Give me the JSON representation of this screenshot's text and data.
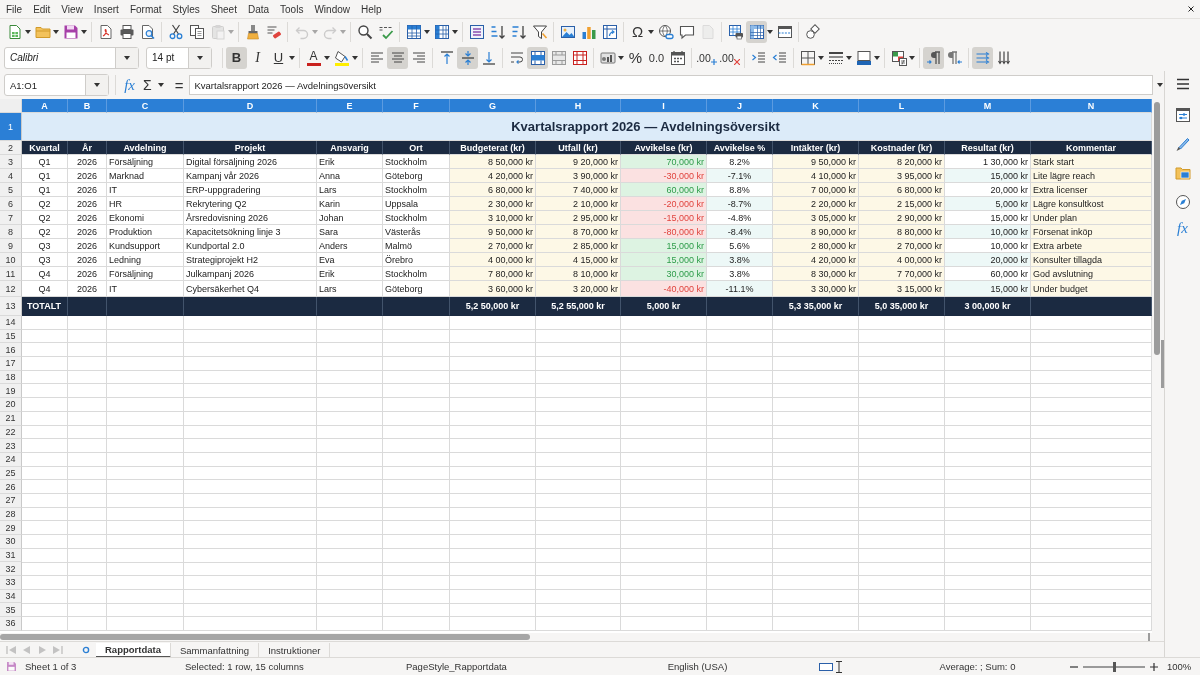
{
  "menu_bar": [
    "File",
    "Edit",
    "View",
    "Insert",
    "Format",
    "Styles",
    "Sheet",
    "Data",
    "Tools",
    "Window",
    "Help"
  ],
  "standard_toolbar": {
    "paste_enabled": false,
    "undo_enabled": false,
    "redo_enabled": false,
    "special_character": "Ω",
    "header_footer_enabled": false,
    "freeze_rows_columns": true
  },
  "formatting_toolbar": {
    "font_name": "Calibri",
    "font_size": "14 pt",
    "bold": {
      "label": "B",
      "on": true
    },
    "italic": {
      "label": "I",
      "on": false
    },
    "underline": {
      "label": "U",
      "on": false
    },
    "font_color_label": "A",
    "align_left": false,
    "align_center": true,
    "align_right": false,
    "align_top": false,
    "align_middle": true,
    "align_bottom": false,
    "merge_and_center": true,
    "percent": "%",
    "number_format": "0.0",
    "add_decimal": ".00",
    "delete_decimal": ".00",
    "left_to_right": true,
    "right_to_left": false,
    "text_horizontal": true,
    "text_vertical": false
  },
  "formula_bar": {
    "name_box": "A1:O1",
    "function_wizard": "fx",
    "sum": "Σ",
    "equals": "=",
    "content": "Kvartalsrapport 2026 — Avdelningsöversikt"
  },
  "sheet": {
    "columns": [
      {
        "letter": "A",
        "selected": true
      },
      {
        "letter": "B",
        "selected": true
      },
      {
        "letter": "C",
        "selected": true
      },
      {
        "letter": "D",
        "selected": true
      },
      {
        "letter": "E",
        "selected": true
      },
      {
        "letter": "F",
        "selected": true
      },
      {
        "letter": "G",
        "selected": true
      },
      {
        "letter": "H",
        "selected": true
      },
      {
        "letter": "I",
        "selected": true
      },
      {
        "letter": "J",
        "selected": true
      },
      {
        "letter": "K",
        "selected": true
      },
      {
        "letter": "L",
        "selected": true
      },
      {
        "letter": "M",
        "selected": true
      },
      {
        "letter": "N",
        "selected": true
      }
    ],
    "title_row": {
      "row": "1",
      "selected": true,
      "text": "Kvartalsrapport 2026 — Avdelningsöversikt"
    },
    "header_row": {
      "row": "2",
      "selected": false,
      "cells": [
        "Kvartal",
        "År",
        "Avdelning",
        "Projekt",
        "Ansvarig",
        "Ort",
        "Budgeterat (kr)",
        "Utfall (kr)",
        "Avvikelse (kr)",
        "Avvikelse %",
        "Intäkter (kr)",
        "Kostnader (kr)",
        "Resultat (kr)",
        "Kommentar"
      ]
    },
    "rows": [
      {
        "row": "3",
        "selected": false,
        "variance_positive": true,
        "cells": [
          "Q1",
          "2026",
          "Försäljning",
          "Digital försäljning 2026",
          "Erik",
          "Stockholm",
          "8 50,000 kr",
          "9 20,000 kr",
          "70,000 kr",
          "8.2%",
          "9 50,000 kr",
          "8 20,000 kr",
          "1 30,000 kr",
          "Stark start"
        ]
      },
      {
        "row": "4",
        "selected": false,
        "variance_positive": false,
        "cells": [
          "Q1",
          "2026",
          "Marknad",
          "Kampanj vår 2026",
          "Anna",
          "Göteborg",
          "4 20,000 kr",
          "3 90,000 kr",
          "-30,000 kr",
          "-7.1%",
          "4 10,000 kr",
          "3 95,000 kr",
          "15,000 kr",
          "Lite lägre reach"
        ]
      },
      {
        "row": "5",
        "selected": false,
        "variance_positive": true,
        "cells": [
          "Q1",
          "2026",
          "IT",
          "ERP-uppgradering",
          "Lars",
          "Stockholm",
          "6 80,000 kr",
          "7 40,000 kr",
          "60,000 kr",
          "8.8%",
          "7 00,000 kr",
          "6 80,000 kr",
          "20,000 kr",
          "Extra licenser"
        ]
      },
      {
        "row": "6",
        "selected": false,
        "variance_positive": false,
        "cells": [
          "Q2",
          "2026",
          "HR",
          "Rekrytering Q2",
          "Karin",
          "Uppsala",
          "2 30,000 kr",
          "2 10,000 kr",
          "-20,000 kr",
          "-8.7%",
          "2 20,000 kr",
          "2 15,000 kr",
          "5,000 kr",
          "Lägre konsultkost"
        ]
      },
      {
        "row": "7",
        "selected": false,
        "variance_positive": false,
        "cells": [
          "Q2",
          "2026",
          "Ekonomi",
          "Årsredovisning 2026",
          "Johan",
          "Stockholm",
          "3 10,000 kr",
          "2 95,000 kr",
          "-15,000 kr",
          "-4.8%",
          "3 05,000 kr",
          "2 90,000 kr",
          "15,000 kr",
          "Under plan"
        ]
      },
      {
        "row": "8",
        "selected": false,
        "variance_positive": false,
        "cells": [
          "Q2",
          "2026",
          "Produktion",
          "Kapacitetsökning linje 3",
          "Sara",
          "Västerås",
          "9 50,000 kr",
          "8 70,000 kr",
          "-80,000 kr",
          "-8.4%",
          "8 90,000 kr",
          "8 80,000 kr",
          "10,000 kr",
          "Försenat inköp"
        ]
      },
      {
        "row": "9",
        "selected": false,
        "variance_positive": true,
        "cells": [
          "Q3",
          "2026",
          "Kundsupport",
          "Kundportal 2.0",
          "Anders",
          "Malmö",
          "2 70,000 kr",
          "2 85,000 kr",
          "15,000 kr",
          "5.6%",
          "2 80,000 kr",
          "2 70,000 kr",
          "10,000 kr",
          "Extra arbete"
        ]
      },
      {
        "row": "10",
        "selected": false,
        "variance_positive": true,
        "cells": [
          "Q3",
          "2026",
          "Ledning",
          "Strategiprojekt H2",
          "Eva",
          "Örebro",
          "4 00,000 kr",
          "4 15,000 kr",
          "15,000 kr",
          "3.8%",
          "4 20,000 kr",
          "4 00,000 kr",
          "20,000 kr",
          "Konsulter tillagda"
        ]
      },
      {
        "row": "11",
        "selected": false,
        "variance_positive": true,
        "cells": [
          "Q4",
          "2026",
          "Försäljning",
          "Julkampanj 2026",
          "Erik",
          "Stockholm",
          "7 80,000 kr",
          "8 10,000 kr",
          "30,000 kr",
          "3.8%",
          "8 30,000 kr",
          "7 70,000 kr",
          "60,000 kr",
          "God avslutning"
        ]
      },
      {
        "row": "12",
        "selected": false,
        "variance_positive": false,
        "cells": [
          "Q4",
          "2026",
          "IT",
          "Cybersäkerhet Q4",
          "Lars",
          "Göteborg",
          "3 60,000 kr",
          "3 20,000 kr",
          "-40,000 kr",
          "-11.1%",
          "3 30,000 kr",
          "3 15,000 kr",
          "15,000 kr",
          "Under budget"
        ]
      }
    ],
    "total_row": {
      "row": "13",
      "selected": false,
      "cells": {
        "A": "TOTALT",
        "G": "5,2 50,000 kr",
        "H": "5,2 55,000 kr",
        "I": "5,000 kr",
        "K": "5,3 35,000 kr",
        "L": "5,0 35,000 kr",
        "M": "3 00,000 kr"
      }
    },
    "empty_rows": [
      {
        "row": "14",
        "selected": false
      },
      {
        "row": "15",
        "selected": false
      },
      {
        "row": "16",
        "selected": false
      },
      {
        "row": "17",
        "selected": false
      },
      {
        "row": "18",
        "selected": false
      },
      {
        "row": "19",
        "selected": false
      },
      {
        "row": "20",
        "selected": false
      },
      {
        "row": "21",
        "selected": false
      },
      {
        "row": "22",
        "selected": false
      },
      {
        "row": "23",
        "selected": false
      },
      {
        "row": "24",
        "selected": false
      },
      {
        "row": "25",
        "selected": false
      },
      {
        "row": "26",
        "selected": false
      },
      {
        "row": "27",
        "selected": false
      },
      {
        "row": "28",
        "selected": false
      },
      {
        "row": "29",
        "selected": false
      },
      {
        "row": "30",
        "selected": false
      },
      {
        "row": "31",
        "selected": false
      },
      {
        "row": "32",
        "selected": false
      },
      {
        "row": "33",
        "selected": false
      },
      {
        "row": "34",
        "selected": false
      },
      {
        "row": "35",
        "selected": false
      },
      {
        "row": "36",
        "selected": false
      }
    ]
  },
  "sidebar": {
    "functions": "fx"
  },
  "sheet_tabs": {
    "navigation_enabled": false,
    "tabs": [
      {
        "label": "Rapportdata",
        "selected": true
      },
      {
        "label": "Sammanfattning",
        "selected": false
      },
      {
        "label": "Instruktioner",
        "selected": false
      }
    ]
  },
  "status_bar": {
    "sheet": "Sheet 1 of 3",
    "selection": "Selected: 1 row, 15 columns",
    "page_style": "PageStyle_Rapportdata",
    "language": "English (USA)",
    "summary": "Average: ; Sum: 0",
    "zoom_slider": {
      "level": 0.5
    },
    "zoom": "100%"
  }
}
